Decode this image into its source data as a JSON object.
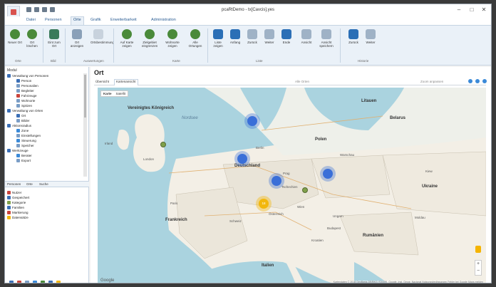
{
  "window": {
    "title": "pcaRtDemo - tx[Cavcis].yes",
    "controls": [
      "–",
      "□",
      "✕"
    ]
  },
  "ribbon_tabs": [
    "Datei",
    "Personen",
    "Orte",
    "Grafik",
    "Erweiterbarkeit",
    "Administration"
  ],
  "ribbon_active_tab": "Orte",
  "ribbon_buttons": [
    {
      "label": "Neuer Ort",
      "icon": "globe-add-icon"
    },
    {
      "label": "Ort löschen",
      "icon": "globe-delete-icon"
    },
    {
      "label": "Eint zum Ort",
      "icon": "map-icon"
    },
    {
      "label": "Ort anzeigen",
      "icon": "map-pin-icon"
    },
    {
      "label": "Ortsbestimmung",
      "icon": "locate-icon"
    },
    {
      "label": "Auf Karte zeigen",
      "icon": "person-map-icon"
    },
    {
      "label": "Zielgebiet eingrenzen",
      "icon": "person-area-icon"
    },
    {
      "label": "Wohnorte zeigen",
      "icon": "person-home-icon"
    },
    {
      "label": "Alle Ortungen",
      "icon": "person-all-icon"
    },
    {
      "label": "Liste zeigen",
      "icon": "list-icon"
    },
    {
      "label": "Anfang",
      "icon": "first-icon"
    },
    {
      "label": "Zurück",
      "icon": "back-icon"
    },
    {
      "label": "Weiter",
      "icon": "next-icon"
    },
    {
      "label": "Ende",
      "icon": "last-icon"
    },
    {
      "label": "Ansicht",
      "icon": "view-icon"
    },
    {
      "label": "Ansicht speichern",
      "icon": "save-view-icon"
    },
    {
      "label": "Zurück",
      "icon": "arrow-left-icon"
    },
    {
      "label": "Weiter",
      "icon": "arrow-right-icon"
    }
  ],
  "ribbon_groups": [
    "Orte",
    "Bild",
    "Auswertungen",
    "Karte",
    "Liste",
    "Historie"
  ],
  "sidebar": {
    "title": "Modul",
    "tree": [
      {
        "label": "Verwaltung von Personen",
        "color": "#3b6fb6",
        "indent": 0
      },
      {
        "label": "Person",
        "color": "#3b6fb6",
        "indent": 1
      },
      {
        "label": "Personalien",
        "color": "#7a9dc6",
        "indent": 1
      },
      {
        "label": "Begleiter",
        "color": "#7a9dc6",
        "indent": 1
      },
      {
        "label": "Fahrzeuge",
        "color": "#c9443c",
        "indent": 1
      },
      {
        "label": "Wohnorte",
        "color": "#7a9dc6",
        "indent": 1
      },
      {
        "label": "Spitzen",
        "color": "#7a9dc6",
        "indent": 1
      },
      {
        "label": "Verwaltung von Orten",
        "color": "#3b6fb6",
        "indent": 0
      },
      {
        "label": "Ort",
        "color": "#3b6fb6",
        "indent": 1
      },
      {
        "label": "Bilder",
        "color": "#7a9dc6",
        "indent": 1
      },
      {
        "label": "Aktionsradius",
        "color": "#3b6fb6",
        "indent": 0
      },
      {
        "label": "Zone",
        "color": "#3b8ad8",
        "indent": 1
      },
      {
        "label": "Einstellungen",
        "color": "#7a9dc6",
        "indent": 1
      },
      {
        "label": "Steuerung",
        "color": "#3b8ad8",
        "indent": 1
      },
      {
        "label": "Speicher",
        "color": "#7a9dc6",
        "indent": 1
      },
      {
        "label": "Werkzeuge",
        "color": "#3b6fb6",
        "indent": 0
      },
      {
        "label": "Berater",
        "color": "#3b8ad8",
        "indent": 1
      },
      {
        "label": "Export",
        "color": "#7a9dc6",
        "indent": 1
      }
    ],
    "bottom_tabs": [
      "Personen",
      "Orte",
      "Suche"
    ],
    "tree2": [
      {
        "label": "Nutzer",
        "color": "#c9443c"
      },
      {
        "label": "Gespeichert",
        "color": "#3b6fb6"
      },
      {
        "label": "Kategorie",
        "color": "#7fa04a"
      },
      {
        "label": "Familien",
        "color": "#3b6fb6"
      },
      {
        "label": "Markierung",
        "color": "#c9443c"
      },
      {
        "label": "Datensätze",
        "color": "#f2b70c"
      }
    ],
    "footer_icons": [
      "person-icon",
      "person-red-icon",
      "gear-icon",
      "monitor-icon",
      "globe-icon",
      "people-icon",
      "star-icon"
    ]
  },
  "main": {
    "title": "Ort",
    "tabs": [
      "Übersicht",
      "Kartenansicht"
    ],
    "active_tab": "Kartenansicht",
    "toolbar_hints": [
      "Alle Orten",
      "Zoom anpassen"
    ],
    "map_type": [
      "Karte",
      "Satellit"
    ],
    "zoom": [
      "+",
      "−"
    ],
    "google_logo": "Google",
    "attribution": "Kartendaten © 2018 GeoBasis-DE/BKG (©2009), Google, Inst. Geogr. Nacional   Nutzungsbedingungen   Fehler bei Google Maps melden",
    "labels": {
      "kingdom": "Vereinigtes Königreich",
      "deutschland": "Deutschland",
      "polen": "Polen",
      "frankreich": "Frankreich",
      "italien": "Italien",
      "rumaenien": "Rumänien",
      "ukraine": "Ukraine",
      "litauen": "Litauen",
      "belarus": "Belarus",
      "nordsee": "Nordsee",
      "irland": "Irland",
      "tschechien": "Tschechien",
      "oesterreich": "Österreich",
      "schweiz": "Schweiz",
      "ungarn": "Ungarn",
      "kroatien": "Kroatien",
      "moldau": "Moldau",
      "london": "London",
      "paris": "Paris",
      "berlin": "Berlin",
      "warschau": "Warschau",
      "kiew": "Kiew",
      "budapest": "Budapest",
      "wien": "Wien",
      "prag": "Prag"
    },
    "clusters": [
      "",
      "",
      "",
      "",
      ""
    ],
    "yellow_cluster": "18"
  }
}
